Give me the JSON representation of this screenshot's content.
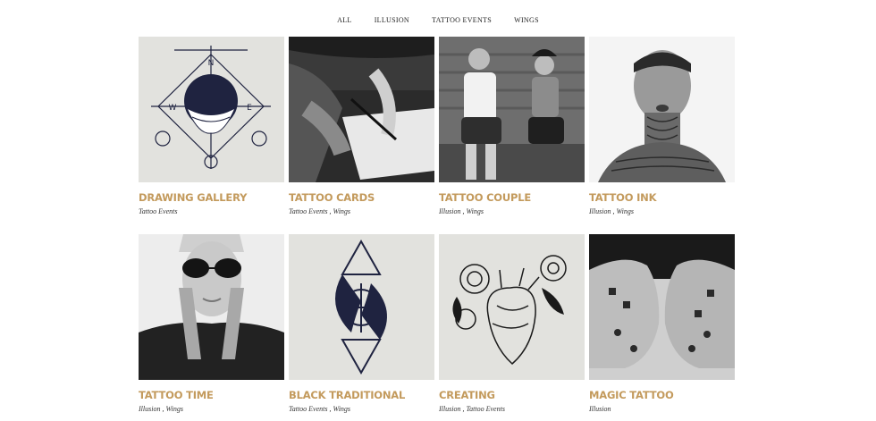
{
  "filters": [
    "ALL",
    "ILLUSION",
    "TATTOO EVENTS",
    "WINGS"
  ],
  "items": [
    {
      "title": "DRAWING GALLERY",
      "categories": "Tattoo Events"
    },
    {
      "title": "TATTOO CARDS",
      "categories": "Tattoo Events , Wings"
    },
    {
      "title": "TATTOO COUPLE",
      "categories": "Illusion , Wings"
    },
    {
      "title": "TATTOO INK",
      "categories": "Illusion , Wings"
    },
    {
      "title": "TATTOO TIME",
      "categories": "Illusion , Wings"
    },
    {
      "title": "BLACK TRADITIONAL",
      "categories": "Tattoo Events , Wings"
    },
    {
      "title": "CREATING",
      "categories": "Illusion , Tattoo Events"
    },
    {
      "title": "MAGIC TATTOO",
      "categories": "Illusion"
    }
  ],
  "colors": {
    "accent": "#c39a5c",
    "ink": "#1f2340",
    "paper": "#e2e2de"
  }
}
